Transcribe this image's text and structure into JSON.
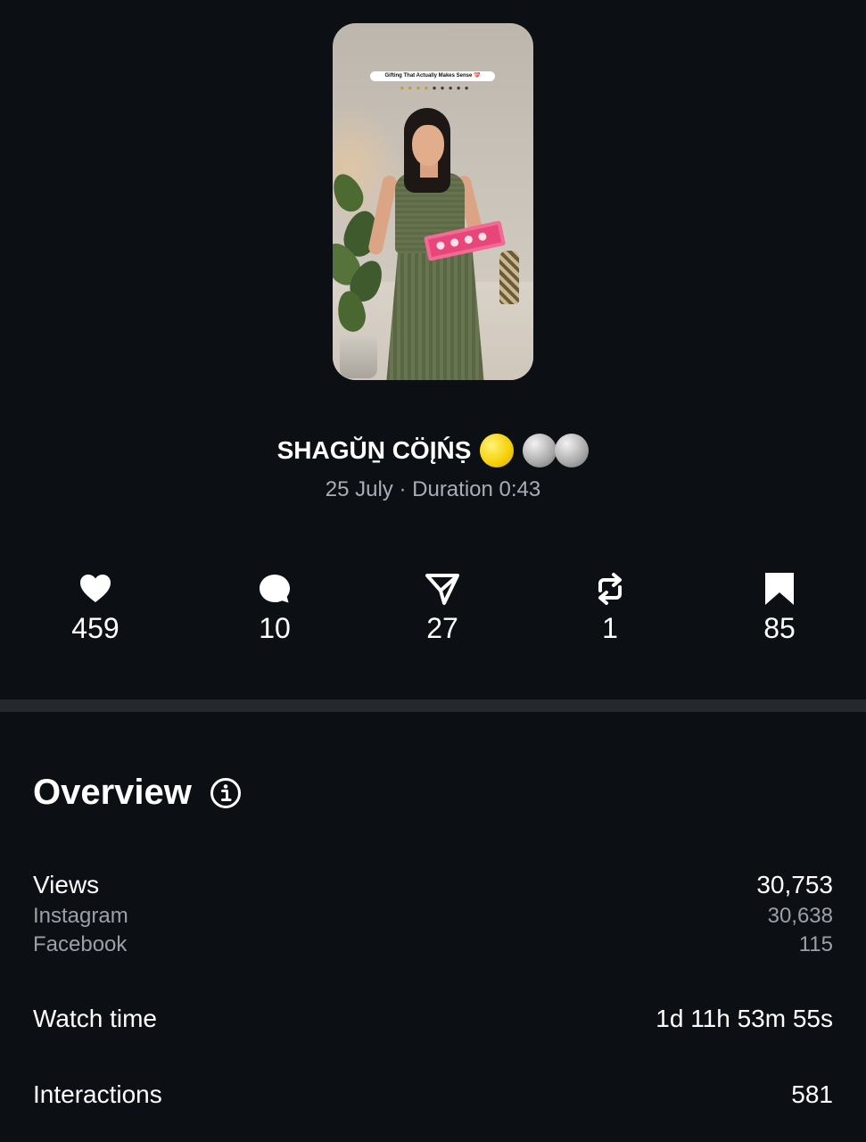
{
  "post": {
    "thumbnail": {
      "caption": "Gifting That Actually Makes Sense 💝"
    },
    "title": "SHAGŬṈ CÖĮŃṢ",
    "meta": "25 July · Duration 0:43"
  },
  "stats": [
    {
      "icon": "heart-icon",
      "value": "459"
    },
    {
      "icon": "comment-icon",
      "value": "10"
    },
    {
      "icon": "share-icon",
      "value": "27"
    },
    {
      "icon": "repost-icon",
      "value": "1"
    },
    {
      "icon": "bookmark-icon",
      "value": "85"
    }
  ],
  "overview": {
    "title": "Overview",
    "views": {
      "label": "Views",
      "value": "30,753",
      "breakdown": [
        {
          "label": "Instagram",
          "value": "30,638"
        },
        {
          "label": "Facebook",
          "value": "115"
        }
      ]
    },
    "watch_time": {
      "label": "Watch time",
      "value": "1d 11h 53m 55s"
    },
    "interactions": {
      "label": "Interactions",
      "value": "581"
    }
  },
  "colors": {
    "background": "#0c1014",
    "divider": "#25282c",
    "secondary_text": "#9aa0a8"
  }
}
